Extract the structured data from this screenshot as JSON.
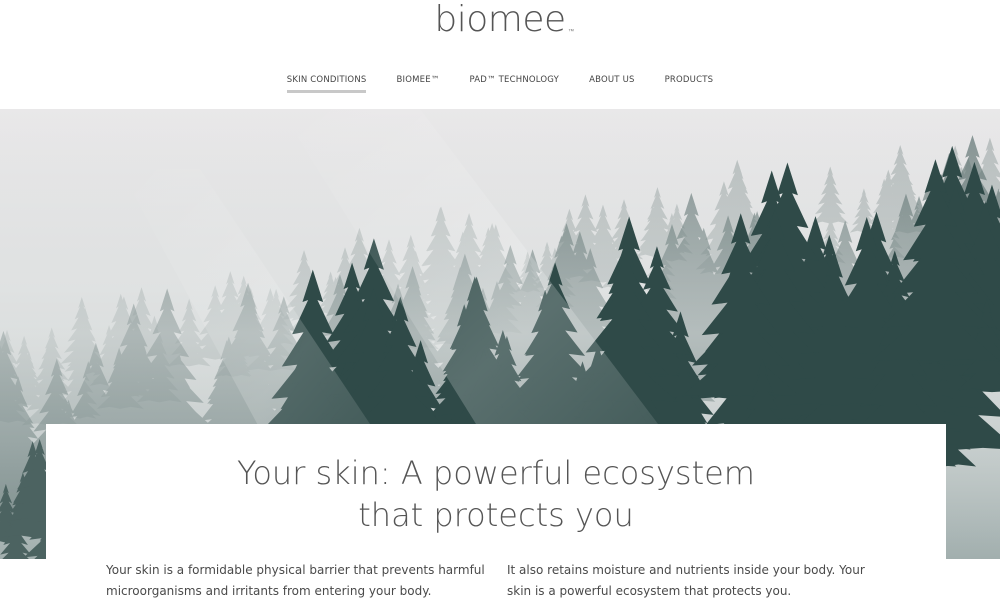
{
  "brand": {
    "logo_text": "biomee",
    "logo_mark": "™"
  },
  "nav": {
    "items": [
      {
        "label": "SKIN CONDITIONS",
        "active": true
      },
      {
        "label": "BIOMEE™",
        "active": false
      },
      {
        "label": "PAD™ TECHNOLOGY",
        "active": false
      },
      {
        "label": "ABOUT US",
        "active": false
      },
      {
        "label": "PRODUCTS",
        "active": false
      }
    ]
  },
  "hero": {
    "image_description": "misty-forest-hero-image"
  },
  "content": {
    "headline_line1": "Your skin: A powerful ecosystem",
    "headline_line2": "that protects you",
    "col_left": "Your skin is a formidable physical barrier that prevents harmful microorganisms and irritants from entering your body.",
    "col_right": "It also retains moisture and nutrients inside your body. Your skin is a powerful ecosystem that protects you."
  },
  "colors": {
    "nav_underline": "#c8c8c8",
    "text": "#4a4a4a",
    "forest_dark": "#2f4a48"
  }
}
